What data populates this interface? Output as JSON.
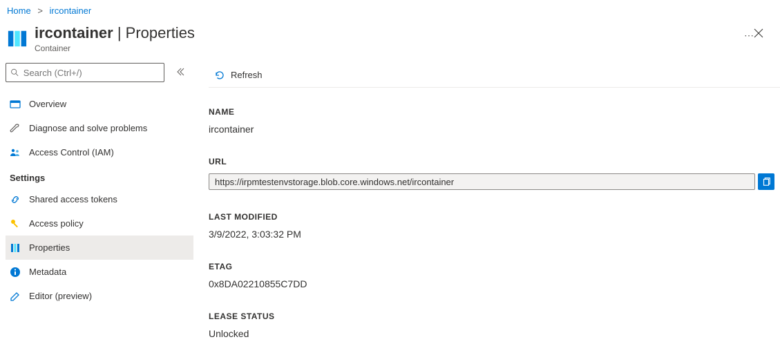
{
  "breadcrumb": {
    "home": "Home",
    "current": "ircontainer"
  },
  "header": {
    "resource": "ircontainer",
    "page": "Properties",
    "sep": " | ",
    "subtitle": "Container"
  },
  "search": {
    "placeholder": "Search (Ctrl+/)"
  },
  "nav": {
    "overview": "Overview",
    "diagnose": "Diagnose and solve problems",
    "iam": "Access Control (IAM)",
    "settings_heading": "Settings",
    "sas": "Shared access tokens",
    "access_policy": "Access policy",
    "properties": "Properties",
    "metadata": "Metadata",
    "editor": "Editor (preview)"
  },
  "toolbar": {
    "refresh": "Refresh"
  },
  "props": {
    "name_label": "NAME",
    "name_value": "ircontainer",
    "url_label": "URL",
    "url_value": "https://irpmtestenvstorage.blob.core.windows.net/ircontainer",
    "last_modified_label": "LAST MODIFIED",
    "last_modified_value": "3/9/2022, 3:03:32 PM",
    "etag_label": "ETAG",
    "etag_value": "0x8DA02210855C7DD",
    "lease_status_label": "LEASE STATUS",
    "lease_status_value": "Unlocked"
  }
}
